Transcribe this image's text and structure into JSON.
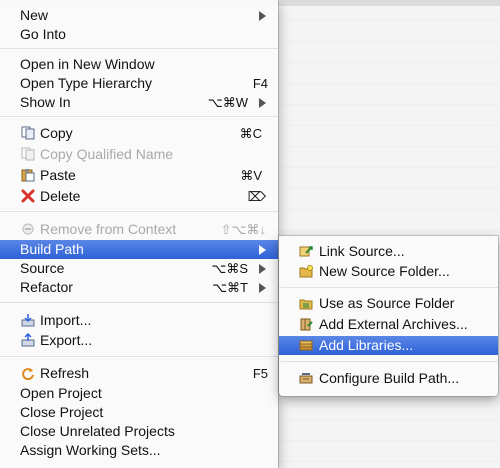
{
  "menu": {
    "items": [
      {
        "label": "New",
        "shortcut": "",
        "submenu": true
      },
      {
        "label": "Go Into",
        "shortcut": ""
      },
      {
        "label": "Open in New Window",
        "shortcut": ""
      },
      {
        "label": "Open Type Hierarchy",
        "shortcut": "F4"
      },
      {
        "label": "Show In",
        "shortcut": "⌥⌘W",
        "submenu": true
      },
      {
        "label": "Copy",
        "shortcut": "⌘C",
        "icon": "copy-icon"
      },
      {
        "label": "Copy Qualified Name",
        "shortcut": "",
        "icon": "copy-qualified-icon",
        "disabled": true
      },
      {
        "label": "Paste",
        "shortcut": "⌘V",
        "icon": "paste-icon"
      },
      {
        "label": "Delete",
        "shortcut": "⌦",
        "icon": "delete-icon"
      },
      {
        "label": "Remove from Context",
        "shortcut": "⇧⌥⌘↓",
        "icon": "remove-context-icon",
        "disabled": true
      },
      {
        "label": "Build Path",
        "shortcut": "",
        "submenu": true,
        "selected": true
      },
      {
        "label": "Source",
        "shortcut": "⌥⌘S",
        "submenu": true
      },
      {
        "label": "Refactor",
        "shortcut": "⌥⌘T",
        "submenu": true
      },
      {
        "label": "Import...",
        "shortcut": "",
        "icon": "import-icon"
      },
      {
        "label": "Export...",
        "shortcut": "",
        "icon": "export-icon"
      },
      {
        "label": "Refresh",
        "shortcut": "F5",
        "icon": "refresh-icon"
      },
      {
        "label": "Open Project",
        "shortcut": ""
      },
      {
        "label": "Close Project",
        "shortcut": ""
      },
      {
        "label": "Close Unrelated Projects",
        "shortcut": ""
      },
      {
        "label": "Assign Working Sets...",
        "shortcut": ""
      }
    ]
  },
  "submenu": {
    "items": [
      {
        "label": "Link Source...",
        "icon": "link-source-icon"
      },
      {
        "label": "New Source Folder...",
        "icon": "new-source-folder-icon"
      },
      {
        "label": "Use as Source Folder",
        "icon": "use-source-folder-icon"
      },
      {
        "label": "Add External Archives...",
        "icon": "add-external-archives-icon"
      },
      {
        "label": "Add Libraries...",
        "icon": "add-libraries-icon",
        "selected": true
      },
      {
        "label": "Configure Build Path...",
        "icon": "configure-build-path-icon"
      }
    ]
  },
  "colors": {
    "selection": "#2f62d8",
    "disabled_text": "#a9a9a9",
    "delete_icon": "#d9342b"
  }
}
